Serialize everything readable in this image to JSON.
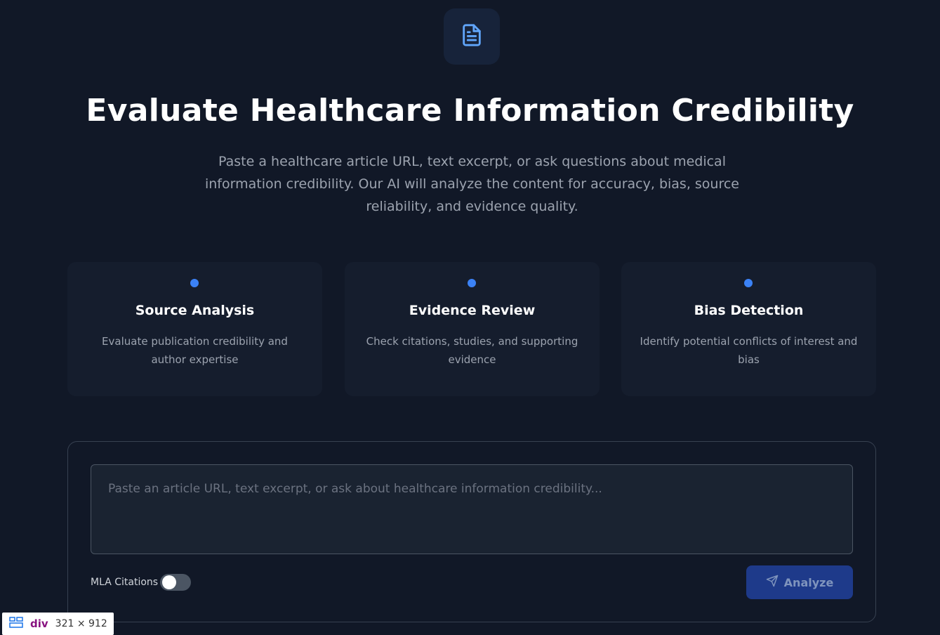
{
  "header": {
    "icon": "document-icon",
    "title": "Evaluate Healthcare Information Credibility",
    "subtitle": "Paste a healthcare article URL, text excerpt, or ask questions about medical information credibility. Our AI will analyze the content for accuracy, bias, source reliability, and evidence quality."
  },
  "features": [
    {
      "title": "Source Analysis",
      "description": "Evaluate publication credibility and author expertise"
    },
    {
      "title": "Evidence Review",
      "description": "Check citations, studies, and supporting evidence"
    },
    {
      "title": "Bias Detection",
      "description": "Identify potential conflicts of interest and bias"
    }
  ],
  "form": {
    "input_value": "",
    "input_placeholder": "Paste an article URL, text excerpt, or ask about healthcare information credibility...",
    "citations_label": "MLA Citations",
    "citations_enabled": false,
    "analyze_label": "Analyze",
    "analyze_icon": "send-icon"
  },
  "devtools": {
    "tag": "div",
    "size": "321 × 912"
  },
  "colors": {
    "background": "#111827",
    "accent": "#3b82f6",
    "button": "#1e3a8a"
  }
}
